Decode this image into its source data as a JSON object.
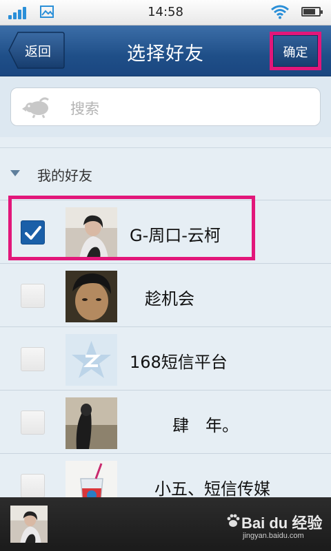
{
  "status_bar": {
    "time": "14:58",
    "icons": [
      "signal-icon",
      "photo-icon",
      "wifi-icon",
      "battery-icon"
    ]
  },
  "title_bar": {
    "back_label": "返回",
    "title": "选择好友",
    "confirm_label": "确定"
  },
  "search": {
    "placeholder": "搜索",
    "icon": "search-icon"
  },
  "group": {
    "label": "我的好友",
    "icon": "triangle-down-icon"
  },
  "friends": [
    {
      "name": "G-周口-云柯",
      "checked": true
    },
    {
      "name": "趁机会",
      "checked": false
    },
    {
      "name": "168短信平台",
      "checked": false
    },
    {
      "name": "肆　年。",
      "checked": false
    },
    {
      "name": "小五、短信传媒",
      "checked": false
    }
  ],
  "watermark": {
    "main": "Bai du 经验",
    "sub": "jingyan.baidu.com"
  },
  "colors": {
    "title_bar": "#1f4f88",
    "highlight": "#e2177a",
    "checkbox_checked": "#1a5fa8",
    "background": "#e6eef4"
  }
}
